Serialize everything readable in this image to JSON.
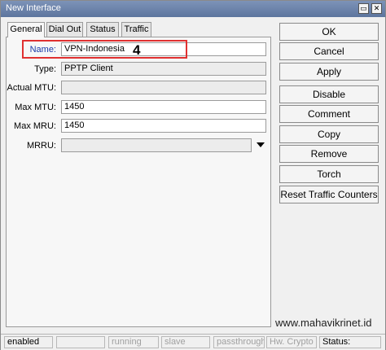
{
  "window": {
    "title": "New Interface",
    "minimize_icon": "restore-icon",
    "close_icon": "close-icon"
  },
  "tabs": [
    {
      "label": "General",
      "active": true
    },
    {
      "label": "Dial Out",
      "active": false
    },
    {
      "label": "Status",
      "active": false
    },
    {
      "label": "Traffic",
      "active": false
    }
  ],
  "form": {
    "name_label": "Name:",
    "name_value": "VPN-Indonesia",
    "type_label": "Type:",
    "type_value": "PPTP Client",
    "actual_mtu_label": "Actual MTU:",
    "actual_mtu_value": "",
    "max_mtu_label": "Max MTU:",
    "max_mtu_value": "1450",
    "max_mru_label": "Max MRU:",
    "max_mru_value": "1450",
    "mrru_label": "MRRU:",
    "mrru_value": ""
  },
  "annotation": {
    "step_number": "4",
    "highlight_color": "#e03030"
  },
  "buttons": [
    "OK",
    "Cancel",
    "Apply",
    "Disable",
    "Comment",
    "Copy",
    "Remove",
    "Torch",
    "Reset Traffic Counters"
  ],
  "watermark": "www.mahavikrinet.id",
  "statusbar": {
    "enabled": "enabled",
    "running": "running",
    "slave": "slave",
    "passthrough": "passthrough",
    "hw_crypto": "Hw. Crypto",
    "status": "Status:"
  }
}
